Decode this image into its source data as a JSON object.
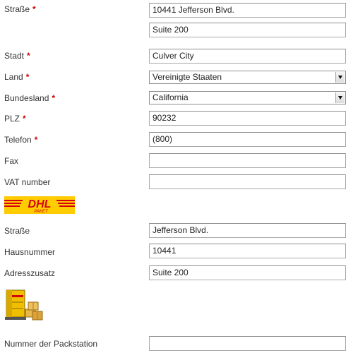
{
  "form": {
    "street": {
      "label": "Straße",
      "value": "10441 Jefferson Blvd."
    },
    "street2": {
      "value": "Suite 200"
    },
    "city": {
      "label": "Stadt",
      "value": "Culver City"
    },
    "country": {
      "label": "Land",
      "value": "Vereinigte Staaten"
    },
    "state": {
      "label": "Bundesland",
      "value": "California"
    },
    "zip": {
      "label": "PLZ",
      "value": "90232"
    },
    "phone": {
      "label": "Telefon",
      "value": "(800)"
    },
    "fax": {
      "label": "Fax",
      "value": ""
    },
    "vat": {
      "label": "VAT number",
      "value": ""
    },
    "required_marker": "*"
  },
  "dhl": {
    "logo_text": "DHL",
    "logo_subtext": "PAKET",
    "logo_colors": {
      "background": "#ffcc00",
      "text": "#d40511"
    },
    "street": {
      "label": "Straße",
      "value": "Jefferson Blvd."
    },
    "house_number": {
      "label": "Hausnummer",
      "value": "10441"
    },
    "address_extra": {
      "label": "Adresszusatz",
      "value": "Suite 200"
    }
  },
  "packstation": {
    "icon": "packstation-icon",
    "number": {
      "label": "Nummer der Packstation",
      "value": ""
    }
  }
}
